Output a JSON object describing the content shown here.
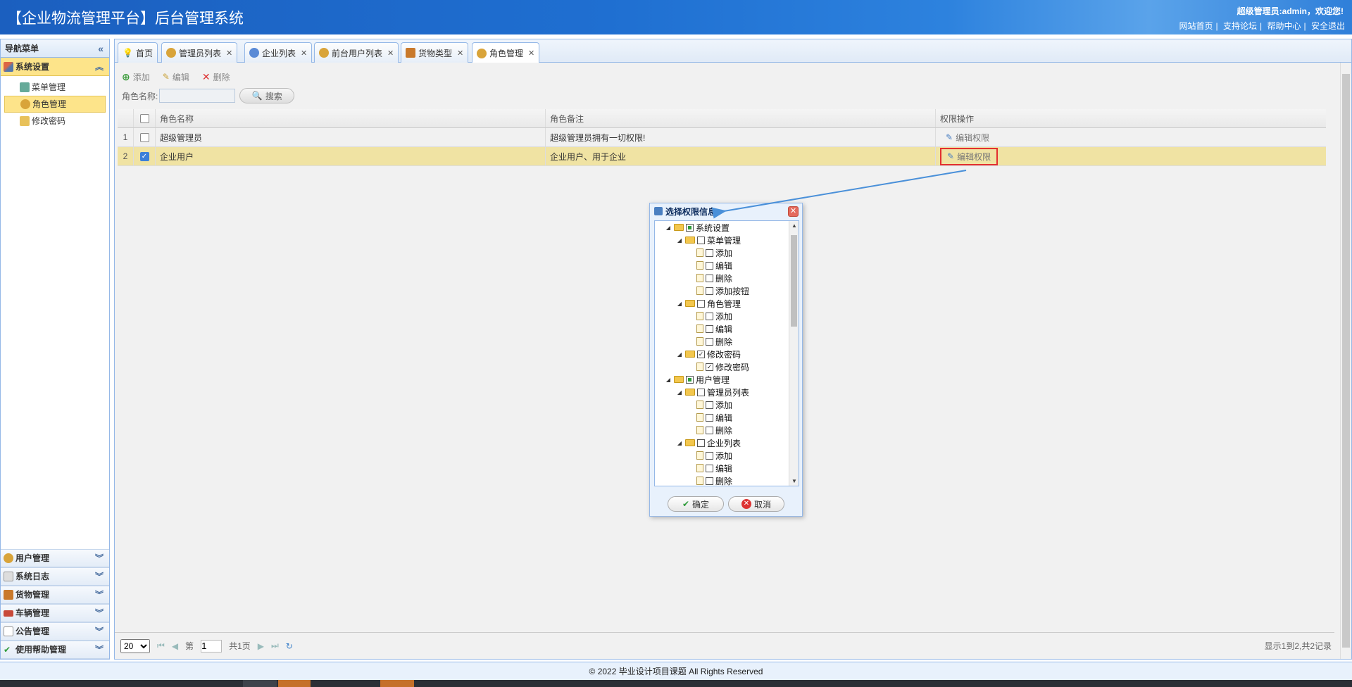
{
  "header": {
    "title": "【企业物流管理平台】后台管理系统",
    "welcome": "超级管理员:admin，欢迎您!",
    "links": [
      "网站首页",
      "支持论坛",
      "帮助中心",
      "安全退出"
    ]
  },
  "sidebar": {
    "title": "导航菜单",
    "active_group": "系统设置",
    "items": [
      "菜单管理",
      "角色管理",
      "修改密码"
    ],
    "selected_item": "角色管理",
    "groups": [
      "用户管理",
      "系统日志",
      "货物管理",
      "车辆管理",
      "公告管理",
      "使用帮助管理"
    ]
  },
  "tabs": [
    "首页",
    "管理员列表",
    "企业列表",
    "前台用户列表",
    "货物类型",
    "角色管理"
  ],
  "active_tab": "角色管理",
  "toolbar": {
    "add": "添加",
    "edit": "编辑",
    "delete": "删除"
  },
  "search": {
    "label": "角色名称:",
    "button": "搜索"
  },
  "grid": {
    "columns": [
      "角色名称",
      "角色备注",
      "权限操作"
    ],
    "rows": [
      {
        "num": "1",
        "name": "超级管理员",
        "remark": "超级管理员拥有一切权限!",
        "op": "编辑权限",
        "checked": false
      },
      {
        "num": "2",
        "name": "企业用户",
        "remark": "企业用户、用于企业",
        "op": "编辑权限",
        "checked": true
      }
    ]
  },
  "pager": {
    "page_size": "20",
    "page_prefix": "第",
    "page_value": "1",
    "page_suffix": "共1页",
    "info": "显示1到2,共2记录"
  },
  "dialog": {
    "title": "选择权限信息",
    "tree": [
      {
        "label": "系统设置",
        "level": 0,
        "type": "folder",
        "state": "partial"
      },
      {
        "label": "菜单管理",
        "level": 1,
        "type": "folder",
        "state": "off"
      },
      {
        "label": "添加",
        "level": 2,
        "type": "file",
        "state": "off"
      },
      {
        "label": "编辑",
        "level": 2,
        "type": "file",
        "state": "off"
      },
      {
        "label": "删除",
        "level": 2,
        "type": "file",
        "state": "off"
      },
      {
        "label": "添加按钮",
        "level": 2,
        "type": "file",
        "state": "off"
      },
      {
        "label": "角色管理",
        "level": 1,
        "type": "folder",
        "state": "off"
      },
      {
        "label": "添加",
        "level": 2,
        "type": "file",
        "state": "off"
      },
      {
        "label": "编辑",
        "level": 2,
        "type": "file",
        "state": "off"
      },
      {
        "label": "删除",
        "level": 2,
        "type": "file",
        "state": "off"
      },
      {
        "label": "修改密码",
        "level": 1,
        "type": "folder",
        "state": "on"
      },
      {
        "label": "修改密码",
        "level": 2,
        "type": "file",
        "state": "on"
      },
      {
        "label": "用户管理",
        "level": 0,
        "type": "folder",
        "state": "partial"
      },
      {
        "label": "管理员列表",
        "level": 1,
        "type": "folder",
        "state": "off"
      },
      {
        "label": "添加",
        "level": 2,
        "type": "file",
        "state": "off"
      },
      {
        "label": "编辑",
        "level": 2,
        "type": "file",
        "state": "off"
      },
      {
        "label": "删除",
        "level": 2,
        "type": "file",
        "state": "off"
      },
      {
        "label": "企业列表",
        "level": 1,
        "type": "folder",
        "state": "off"
      },
      {
        "label": "添加",
        "level": 2,
        "type": "file",
        "state": "off"
      },
      {
        "label": "编辑",
        "level": 2,
        "type": "file",
        "state": "off"
      },
      {
        "label": "删除",
        "level": 2,
        "type": "file",
        "state": "off"
      }
    ],
    "ok": "确定",
    "cancel": "取消"
  },
  "footer": "© 2022 毕业设计项目课题 All Rights Reserved",
  "colors": {
    "accent": "#1f6fd1",
    "highlight": "#fde48a",
    "annotation_box": "#e3302f",
    "annotation_arrow": "#4a90d9"
  }
}
